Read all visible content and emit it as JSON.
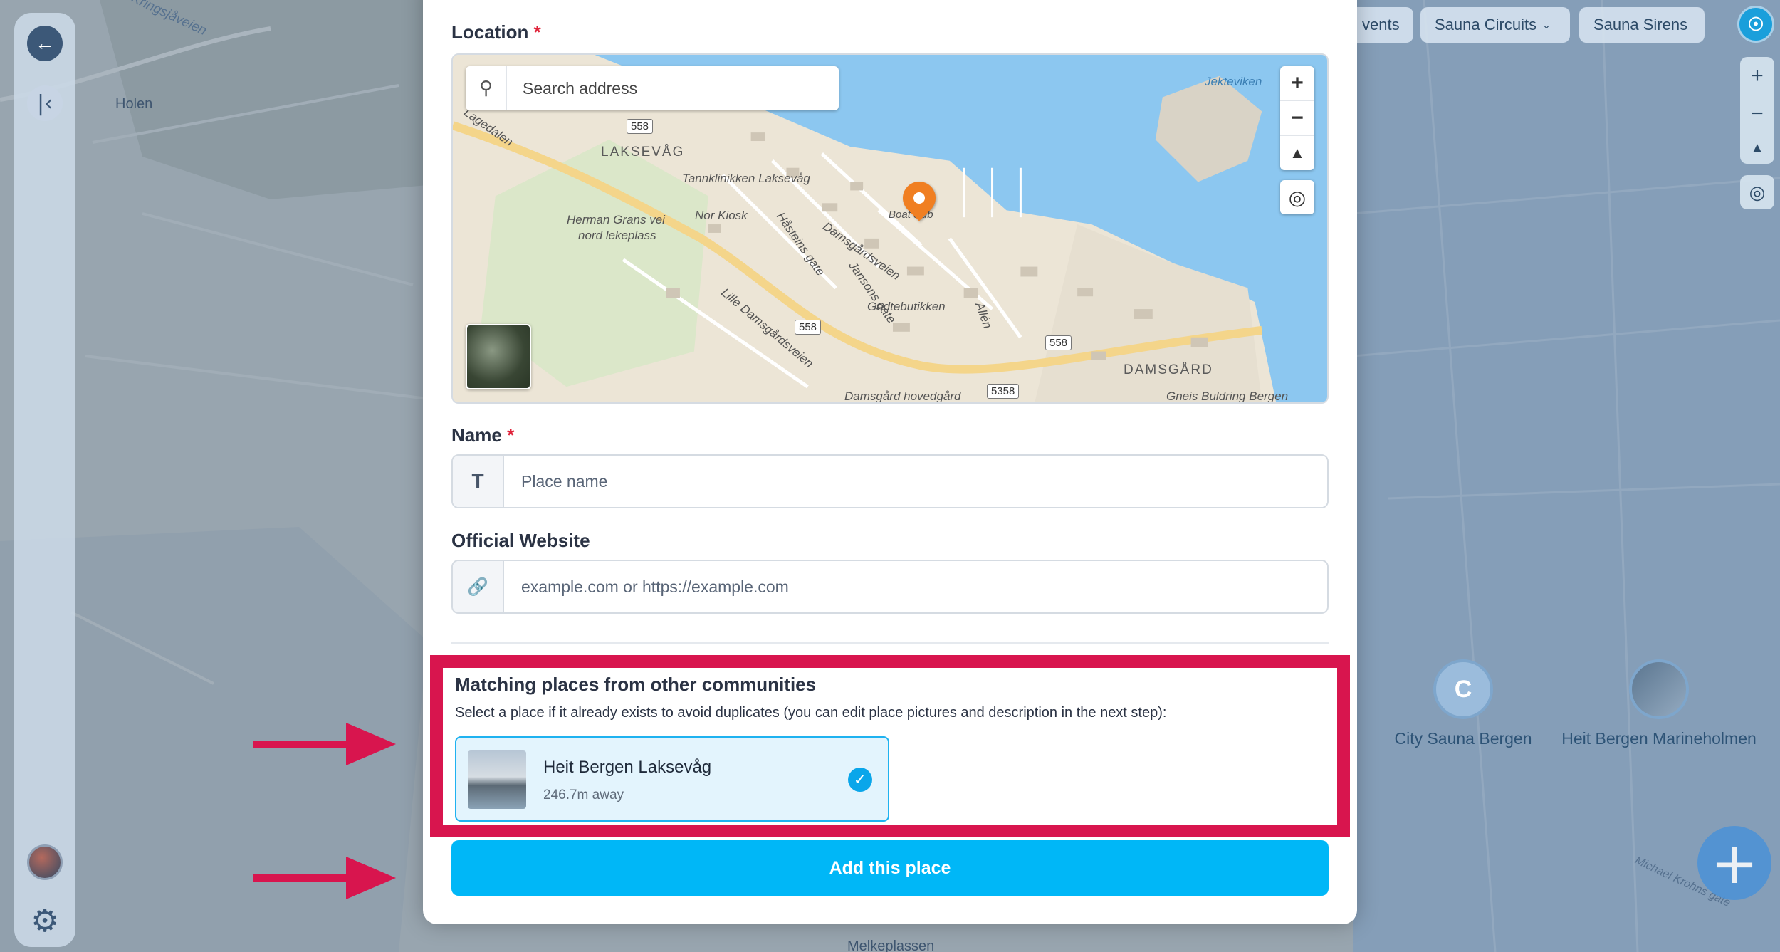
{
  "background": {
    "places": [
      "Kringsjåveien",
      "Holen",
      "Melkeplassen",
      "Michael Krohns gate"
    ],
    "markers": [
      {
        "name": "City Sauna Bergen",
        "icon": "C"
      },
      {
        "name": "Heit Bergen Marineholmen"
      }
    ]
  },
  "topbar": {
    "chips": [
      {
        "label": "vents"
      },
      {
        "label": "Sauna Circuits",
        "has_dropdown": true
      },
      {
        "label": "Sauna Sirens"
      }
    ]
  },
  "form": {
    "location_label": "Location",
    "required_mark": "*",
    "search_placeholder": "Search address",
    "map_labels": {
      "laksevag": "LAKSEVÅG",
      "damsgard": "DAMSGÅRD",
      "jekteviken": "Jekteviken",
      "tannklinikken": "Tannklinikken Laksevåg",
      "herman": "Herman Grans vei",
      "nord": "nord lekeplass",
      "norkiosk": "Nor Kiosk",
      "hastein": "Håsteins gate",
      "damsgardsveien": "Damsgårdsveien",
      "jansons": "Jansons gate",
      "godtebutikken": "Godtebutikken",
      "allen": "Allén",
      "lille": "Lille Damsgårdsveien",
      "hovedgard": "Damsgård hovedgård",
      "gneis": "Gneis Buldring Bergen",
      "club": "Boat club",
      "r558a": "558",
      "r558b": "558",
      "r558c": "558",
      "r5358": "5358",
      "lagedalen": "Lagedalen"
    },
    "name_label": "Name",
    "name_placeholder": "Place name",
    "website_label": "Official Website",
    "website_placeholder": "example.com or https://example.com"
  },
  "matches": {
    "title": "Matching places from other communities",
    "hint": "Select a place if it already exists to avoid duplicates (you can edit place pictures and description in the next step):",
    "items": [
      {
        "name": "Heit Bergen Laksevåg",
        "distance": "246.7m away",
        "selected": true
      }
    ]
  },
  "submit_label": "Add this place",
  "colors": {
    "highlight": "#d8154e",
    "primary": "#00b7f7",
    "pin": "#f07f22"
  },
  "icons": [
    "back-arrow-icon",
    "collapse-icon",
    "gear-icon",
    "search-icon",
    "zoom-in-icon",
    "zoom-out-icon",
    "compass-icon",
    "locate-icon",
    "text-icon",
    "link-icon",
    "check-icon",
    "plus-icon"
  ]
}
